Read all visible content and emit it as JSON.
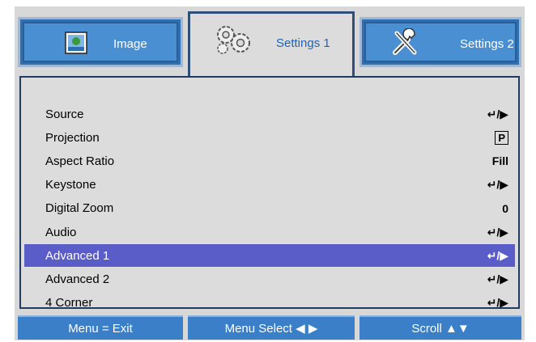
{
  "tabs": [
    {
      "label": "Image",
      "icon": "image-icon"
    },
    {
      "label": "Settings 1",
      "icon": "gears-icon"
    },
    {
      "label": "Settings 2",
      "icon": "tools-icon"
    }
  ],
  "menu": {
    "items": [
      {
        "label": "Source",
        "value": "↵/▶"
      },
      {
        "label": "Projection",
        "value": "P"
      },
      {
        "label": "Aspect Ratio",
        "value": "Fill"
      },
      {
        "label": "Keystone",
        "value": "↵/▶"
      },
      {
        "label": "Digital Zoom",
        "value": "0"
      },
      {
        "label": "Audio",
        "value": "↵/▶"
      },
      {
        "label": "Advanced 1",
        "value": "↵/▶",
        "selected": true
      },
      {
        "label": "Advanced 2",
        "value": "↵/▶"
      },
      {
        "label": "4 Corner",
        "value": "↵/▶"
      }
    ]
  },
  "footer": {
    "exit": "Menu = Exit",
    "select": "Menu Select ◀ ▶",
    "scroll": "Scroll ▲▼"
  },
  "colors": {
    "tab_blue": "#4a8fd2",
    "active_tab_text": "#1f63b8",
    "selected_row": "#5a5cc7",
    "footer_blue": "#3a7fc8"
  }
}
